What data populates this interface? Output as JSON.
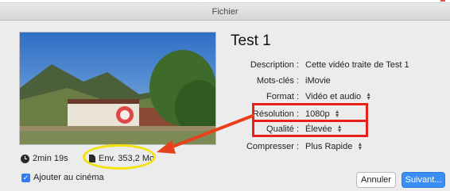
{
  "window": {
    "title": "Fichier"
  },
  "project": {
    "title": "Test 1"
  },
  "fields": {
    "description": {
      "label": "Description :",
      "value": "Cette vidéo traite de Test 1"
    },
    "keywords": {
      "label": "Mots-clés :",
      "value": "iMovie"
    },
    "format": {
      "label": "Format :",
      "value": "Vidéo et audio"
    },
    "resolution": {
      "label": "Résolution :",
      "value": "1080p"
    },
    "quality": {
      "label": "Qualité :",
      "value": "Élevée"
    },
    "compress": {
      "label": "Compresser :",
      "value": "Plus Rapide"
    }
  },
  "info": {
    "duration": "2min 19s",
    "size": "Env. 353,2 Mo"
  },
  "options": {
    "add_to_theater": "Ajouter au cinéma",
    "add_to_theater_checked": true
  },
  "buttons": {
    "cancel": "Annuler",
    "next": "Suivant..."
  },
  "icons": {
    "duration": "clock-icon",
    "size": "file-icon",
    "stepper": "updown-chevron-icon"
  },
  "colors": {
    "highlight_box": "#e8221b",
    "highlight_ring": "#f2e30f",
    "arrow": "#e8401b",
    "primary_button": "#3b8ef6"
  }
}
